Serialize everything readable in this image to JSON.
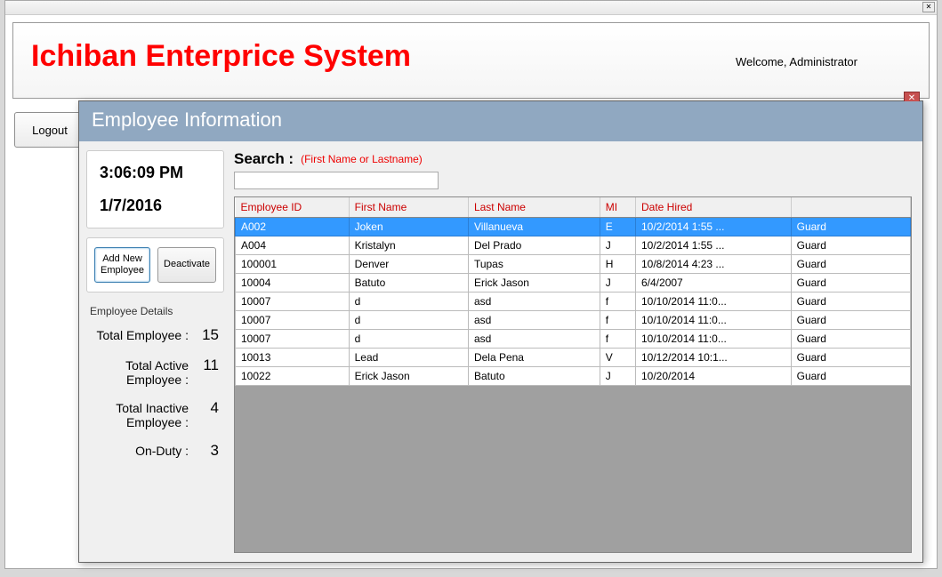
{
  "header": {
    "app_title": "Ichiban Enterprice System",
    "welcome": "Welcome, Administrator",
    "logout": "Logout"
  },
  "dialog": {
    "title": "Employee Information",
    "time": "3:06:09 PM",
    "date": "1/7/2016",
    "buttons": {
      "add": "Add New Employee",
      "deactivate": "Deactivate"
    },
    "details_label": "Employee Details",
    "stats": {
      "total_label": "Total Employee : ",
      "total_val": "15",
      "active_label": "Total Active Employee : ",
      "active_val": "11",
      "inactive_label": "Total Inactive Employee : ",
      "inactive_val": "4",
      "onduty_label": "On-Duty : ",
      "onduty_val": "3"
    },
    "search": {
      "label": "Search :",
      "hint": "(First Name or Lastname)",
      "value": ""
    },
    "columns": {
      "id": "Employee ID",
      "fn": "First Name",
      "ln": "Last Name",
      "mi": "MI",
      "dh": "Date Hired",
      "po": ""
    },
    "rows": [
      {
        "id": "A002",
        "fn": "Joken",
        "ln": "Villanueva",
        "mi": "E",
        "dh": "10/2/2014 1:55 ...",
        "po": "Guard",
        "sel": true
      },
      {
        "id": "A004",
        "fn": "Kristalyn",
        "ln": "Del Prado",
        "mi": "J",
        "dh": "10/2/2014 1:55 ...",
        "po": "Guard"
      },
      {
        "id": "100001",
        "fn": "Denver",
        "ln": "Tupas",
        "mi": "H",
        "dh": "10/8/2014 4:23 ...",
        "po": "Guard"
      },
      {
        "id": "10004",
        "fn": "Batuto",
        "ln": "Erick Jason",
        "mi": "J",
        "dh": "6/4/2007",
        "po": "Guard"
      },
      {
        "id": "10007",
        "fn": "d",
        "ln": "asd",
        "mi": "f",
        "dh": "10/10/2014 11:0...",
        "po": "Guard"
      },
      {
        "id": "10007",
        "fn": "d",
        "ln": "asd",
        "mi": "f",
        "dh": "10/10/2014 11:0...",
        "po": "Guard"
      },
      {
        "id": "10007",
        "fn": "d",
        "ln": "asd",
        "mi": "f",
        "dh": "10/10/2014 11:0...",
        "po": "Guard"
      },
      {
        "id": "10013",
        "fn": "Lead",
        "ln": "Dela Pena",
        "mi": "V",
        "dh": "10/12/2014 10:1...",
        "po": "Guard"
      },
      {
        "id": "10022",
        "fn": "Erick Jason",
        "ln": "Batuto",
        "mi": "J",
        "dh": "10/20/2014",
        "po": "Guard"
      }
    ]
  }
}
